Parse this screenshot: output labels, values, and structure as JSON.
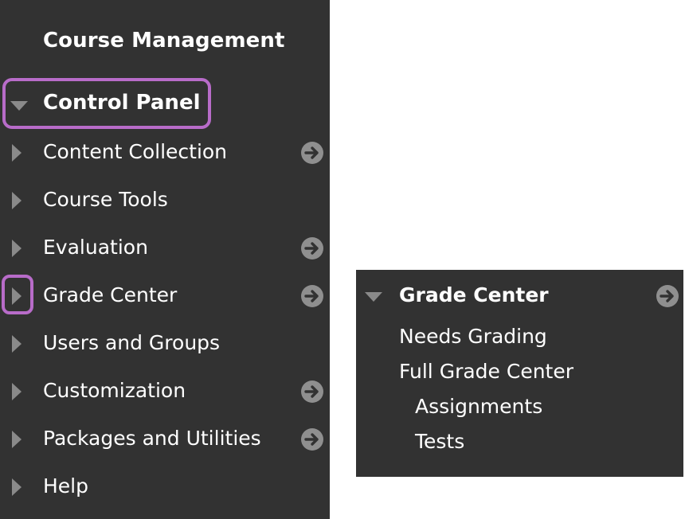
{
  "course_menu": {
    "title": "Course Management",
    "control_panel": "Control Panel",
    "items": [
      {
        "label": "Content Collection",
        "has_arrow": true
      },
      {
        "label": "Course Tools",
        "has_arrow": false
      },
      {
        "label": "Evaluation",
        "has_arrow": true
      },
      {
        "label": "Grade Center",
        "has_arrow": true
      },
      {
        "label": "Users and Groups",
        "has_arrow": false
      },
      {
        "label": "Customization",
        "has_arrow": true
      },
      {
        "label": "Packages and Utilities",
        "has_arrow": true
      },
      {
        "label": "Help",
        "has_arrow": false
      }
    ]
  },
  "grade_center_panel": {
    "title": "Grade Center",
    "items": [
      {
        "label": "Needs Grading"
      },
      {
        "label": "Full Grade Center"
      },
      {
        "label": "Assignments"
      },
      {
        "label": "Tests"
      }
    ]
  },
  "colors": {
    "panel_bg": "#323232",
    "highlight": "#b86cc9",
    "icon": "#8f8f8f"
  },
  "icons": {
    "expand": "caret-right-icon",
    "collapse": "caret-down-icon",
    "go": "arrow-circle-right-icon"
  }
}
